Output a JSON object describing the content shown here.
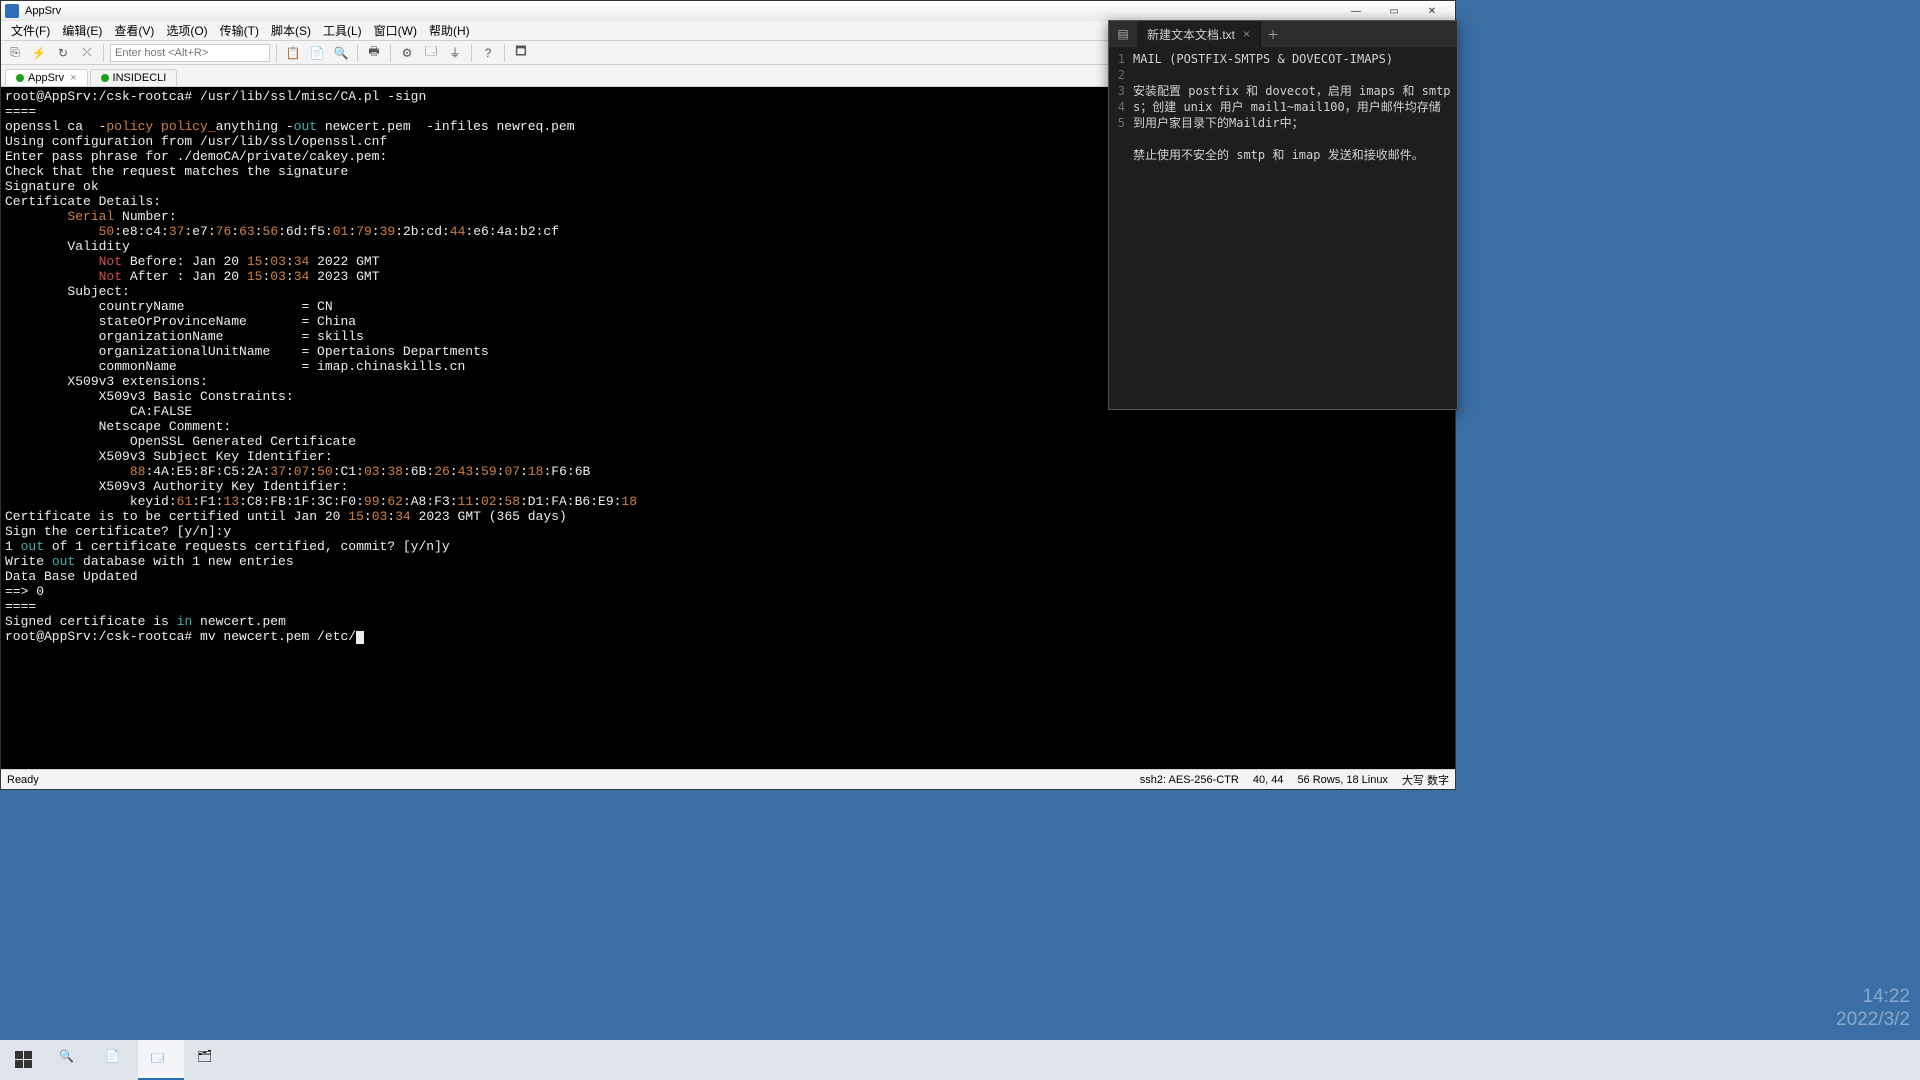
{
  "app": {
    "title": "AppSrv",
    "menus": [
      "文件(F)",
      "编辑(E)",
      "查看(V)",
      "选项(O)",
      "传输(T)",
      "脚本(S)",
      "工具(L)",
      "窗口(W)",
      "帮助(H)"
    ],
    "host_placeholder": "Enter host <Alt+R>",
    "tabs": [
      {
        "label": "AppSrv",
        "active": true
      },
      {
        "label": "INSIDECLI",
        "active": false
      }
    ]
  },
  "terminal": {
    "lines": [
      {
        "segs": [
          {
            "t": "root@AppSrv:/csk-rootca# /usr/lib/ssl/misc/CA.pl -sign"
          }
        ]
      },
      {
        "segs": [
          {
            "t": "===="
          }
        ]
      },
      {
        "segs": [
          {
            "t": "openssl ca  -"
          },
          {
            "t": "policy",
            "c": "c-orange"
          },
          {
            "t": " "
          },
          {
            "t": "policy_",
            "c": "c-orange"
          },
          {
            "t": "anything -"
          },
          {
            "t": "out",
            "c": "c-teal"
          },
          {
            "t": " newcert.pem  -infiles newreq.pem"
          }
        ]
      },
      {
        "segs": [
          {
            "t": "Using configuration from /usr/lib/ssl/openssl.cnf"
          }
        ]
      },
      {
        "segs": [
          {
            "t": "Enter pass phrase for ./demoCA/private/cakey.pem:"
          }
        ]
      },
      {
        "segs": [
          {
            "t": "Check that the request matches the signature"
          }
        ]
      },
      {
        "segs": [
          {
            "t": "Signature ok"
          }
        ]
      },
      {
        "segs": [
          {
            "t": "Certificate Details:"
          }
        ]
      },
      {
        "segs": [
          {
            "t": "        "
          },
          {
            "t": "Serial",
            "c": "c-orange"
          },
          {
            "t": " Number:"
          }
        ]
      },
      {
        "segs": [
          {
            "t": "            "
          },
          {
            "t": "50",
            "c": "c-orange"
          },
          {
            "t": ":e8:c4:"
          },
          {
            "t": "37",
            "c": "c-orange"
          },
          {
            "t": ":e7:"
          },
          {
            "t": "76",
            "c": "c-orange"
          },
          {
            "t": ":"
          },
          {
            "t": "63",
            "c": "c-orange"
          },
          {
            "t": ":"
          },
          {
            "t": "56",
            "c": "c-orange"
          },
          {
            "t": ":6d:f5:"
          },
          {
            "t": "01",
            "c": "c-orange"
          },
          {
            "t": ":"
          },
          {
            "t": "79",
            "c": "c-orange"
          },
          {
            "t": ":"
          },
          {
            "t": "39",
            "c": "c-orange"
          },
          {
            "t": ":2b:cd:"
          },
          {
            "t": "44",
            "c": "c-orange"
          },
          {
            "t": ":e6:4a:b2:cf"
          }
        ]
      },
      {
        "segs": [
          {
            "t": "        Validity"
          }
        ]
      },
      {
        "segs": [
          {
            "t": "            "
          },
          {
            "t": "Not",
            "c": "c-red"
          },
          {
            "t": " Before: Jan 20 "
          },
          {
            "t": "15",
            "c": "c-orange"
          },
          {
            "t": ":"
          },
          {
            "t": "03",
            "c": "c-orange"
          },
          {
            "t": ":"
          },
          {
            "t": "34",
            "c": "c-orange"
          },
          {
            "t": " 2022 GMT"
          }
        ]
      },
      {
        "segs": [
          {
            "t": "            "
          },
          {
            "t": "Not",
            "c": "c-red"
          },
          {
            "t": " After : Jan 20 "
          },
          {
            "t": "15",
            "c": "c-orange"
          },
          {
            "t": ":"
          },
          {
            "t": "03",
            "c": "c-orange"
          },
          {
            "t": ":"
          },
          {
            "t": "34",
            "c": "c-orange"
          },
          {
            "t": " 2023 GMT"
          }
        ]
      },
      {
        "segs": [
          {
            "t": "        Subject:"
          }
        ]
      },
      {
        "segs": [
          {
            "t": "            countryName               = CN"
          }
        ]
      },
      {
        "segs": [
          {
            "t": "            stateOrProvinceName       = China"
          }
        ]
      },
      {
        "segs": [
          {
            "t": "            organizationName          = skills"
          }
        ]
      },
      {
        "segs": [
          {
            "t": "            organizationalUnitName    = Opertaions Departments"
          }
        ]
      },
      {
        "segs": [
          {
            "t": "            commonName                = imap.chinaskills.cn"
          }
        ]
      },
      {
        "segs": [
          {
            "t": "        X509v3 extensions:"
          }
        ]
      },
      {
        "segs": [
          {
            "t": "            X509v3 Basic Constraints:"
          }
        ]
      },
      {
        "segs": [
          {
            "t": "                CA:FALSE"
          }
        ]
      },
      {
        "segs": [
          {
            "t": "            Netscape Comment:"
          }
        ]
      },
      {
        "segs": [
          {
            "t": "                OpenSSL Generated Certificate"
          }
        ]
      },
      {
        "segs": [
          {
            "t": "            X509v3 Subject Key Identifier:"
          }
        ]
      },
      {
        "segs": [
          {
            "t": "                "
          },
          {
            "t": "88",
            "c": "c-orange"
          },
          {
            "t": ":4A:E5:8F:C5:2A:"
          },
          {
            "t": "37",
            "c": "c-orange"
          },
          {
            "t": ":"
          },
          {
            "t": "07",
            "c": "c-orange"
          },
          {
            "t": ":"
          },
          {
            "t": "50",
            "c": "c-orange"
          },
          {
            "t": ":C1:"
          },
          {
            "t": "03",
            "c": "c-orange"
          },
          {
            "t": ":"
          },
          {
            "t": "38",
            "c": "c-orange"
          },
          {
            "t": ":6B:"
          },
          {
            "t": "26",
            "c": "c-orange"
          },
          {
            "t": ":"
          },
          {
            "t": "43",
            "c": "c-orange"
          },
          {
            "t": ":"
          },
          {
            "t": "59",
            "c": "c-orange"
          },
          {
            "t": ":"
          },
          {
            "t": "07",
            "c": "c-orange"
          },
          {
            "t": ":"
          },
          {
            "t": "18",
            "c": "c-orange"
          },
          {
            "t": ":F6:6B"
          }
        ]
      },
      {
        "segs": [
          {
            "t": "            X509v3 Authority Key Identifier:"
          }
        ]
      },
      {
        "segs": [
          {
            "t": "                keyid:"
          },
          {
            "t": "61",
            "c": "c-orange"
          },
          {
            "t": ":F1:"
          },
          {
            "t": "13",
            "c": "c-orange"
          },
          {
            "t": ":C8:FB:1F:3C:F0:"
          },
          {
            "t": "99",
            "c": "c-orange"
          },
          {
            "t": ":"
          },
          {
            "t": "62",
            "c": "c-orange"
          },
          {
            "t": ":A8:F3:"
          },
          {
            "t": "11",
            "c": "c-orange"
          },
          {
            "t": ":"
          },
          {
            "t": "02",
            "c": "c-orange"
          },
          {
            "t": ":"
          },
          {
            "t": "58",
            "c": "c-orange"
          },
          {
            "t": ":D1:FA:B6:E9:"
          },
          {
            "t": "18",
            "c": "c-orange"
          }
        ]
      },
      {
        "segs": [
          {
            "t": ""
          }
        ]
      },
      {
        "segs": [
          {
            "t": "Certificate is to be certified until Jan 20 "
          },
          {
            "t": "15",
            "c": "c-orange"
          },
          {
            "t": ":"
          },
          {
            "t": "03",
            "c": "c-orange"
          },
          {
            "t": ":"
          },
          {
            "t": "34",
            "c": "c-orange"
          },
          {
            "t": " 2023 GMT (365 days)"
          }
        ]
      },
      {
        "segs": [
          {
            "t": "Sign the certificate? [y/n]:y"
          }
        ]
      },
      {
        "segs": [
          {
            "t": ""
          }
        ]
      },
      {
        "segs": [
          {
            "t": ""
          }
        ]
      },
      {
        "segs": [
          {
            "t": "1 "
          },
          {
            "t": "out",
            "c": "c-teal"
          },
          {
            "t": " of 1 certificate requests certified, commit? [y/n]y"
          }
        ]
      },
      {
        "segs": [
          {
            "t": "Write "
          },
          {
            "t": "out",
            "c": "c-teal"
          },
          {
            "t": " database with 1 new entries"
          }
        ]
      },
      {
        "segs": [
          {
            "t": "Data Base Updated"
          }
        ]
      },
      {
        "segs": [
          {
            "t": "==> 0"
          }
        ]
      },
      {
        "segs": [
          {
            "t": "===="
          }
        ]
      },
      {
        "segs": [
          {
            "t": "Signed certificate is "
          },
          {
            "t": "in",
            "c": "c-teal"
          },
          {
            "t": " newcert.pem"
          }
        ]
      },
      {
        "segs": [
          {
            "t": "root@AppSrv:/csk-rootca# mv newcert.pem /etc/"
          }
        ],
        "cursor": true
      }
    ]
  },
  "status": {
    "ready": "Ready",
    "proto": "ssh2: AES-256-CTR",
    "cursor": "40, 44",
    "size": "56 Rows, 18 Linux",
    "caps": "大写 数字"
  },
  "editor": {
    "filename": "新建文本文档.txt",
    "lines": [
      "MAIL (POSTFIX-SMTPS & DOVECOT-IMAPS)",
      "",
      "安装配置 postfix 和 dovecot，启用 imaps 和 smtps；创建 unix 用户 mail1~mail100，用户邮件均存储到用户家目录下的Maildir中；",
      "",
      "禁止使用不安全的 smtp 和 imap 发送和接收邮件。"
    ]
  },
  "desktop": {
    "time": "14:22",
    "date": "2022/3/2"
  }
}
